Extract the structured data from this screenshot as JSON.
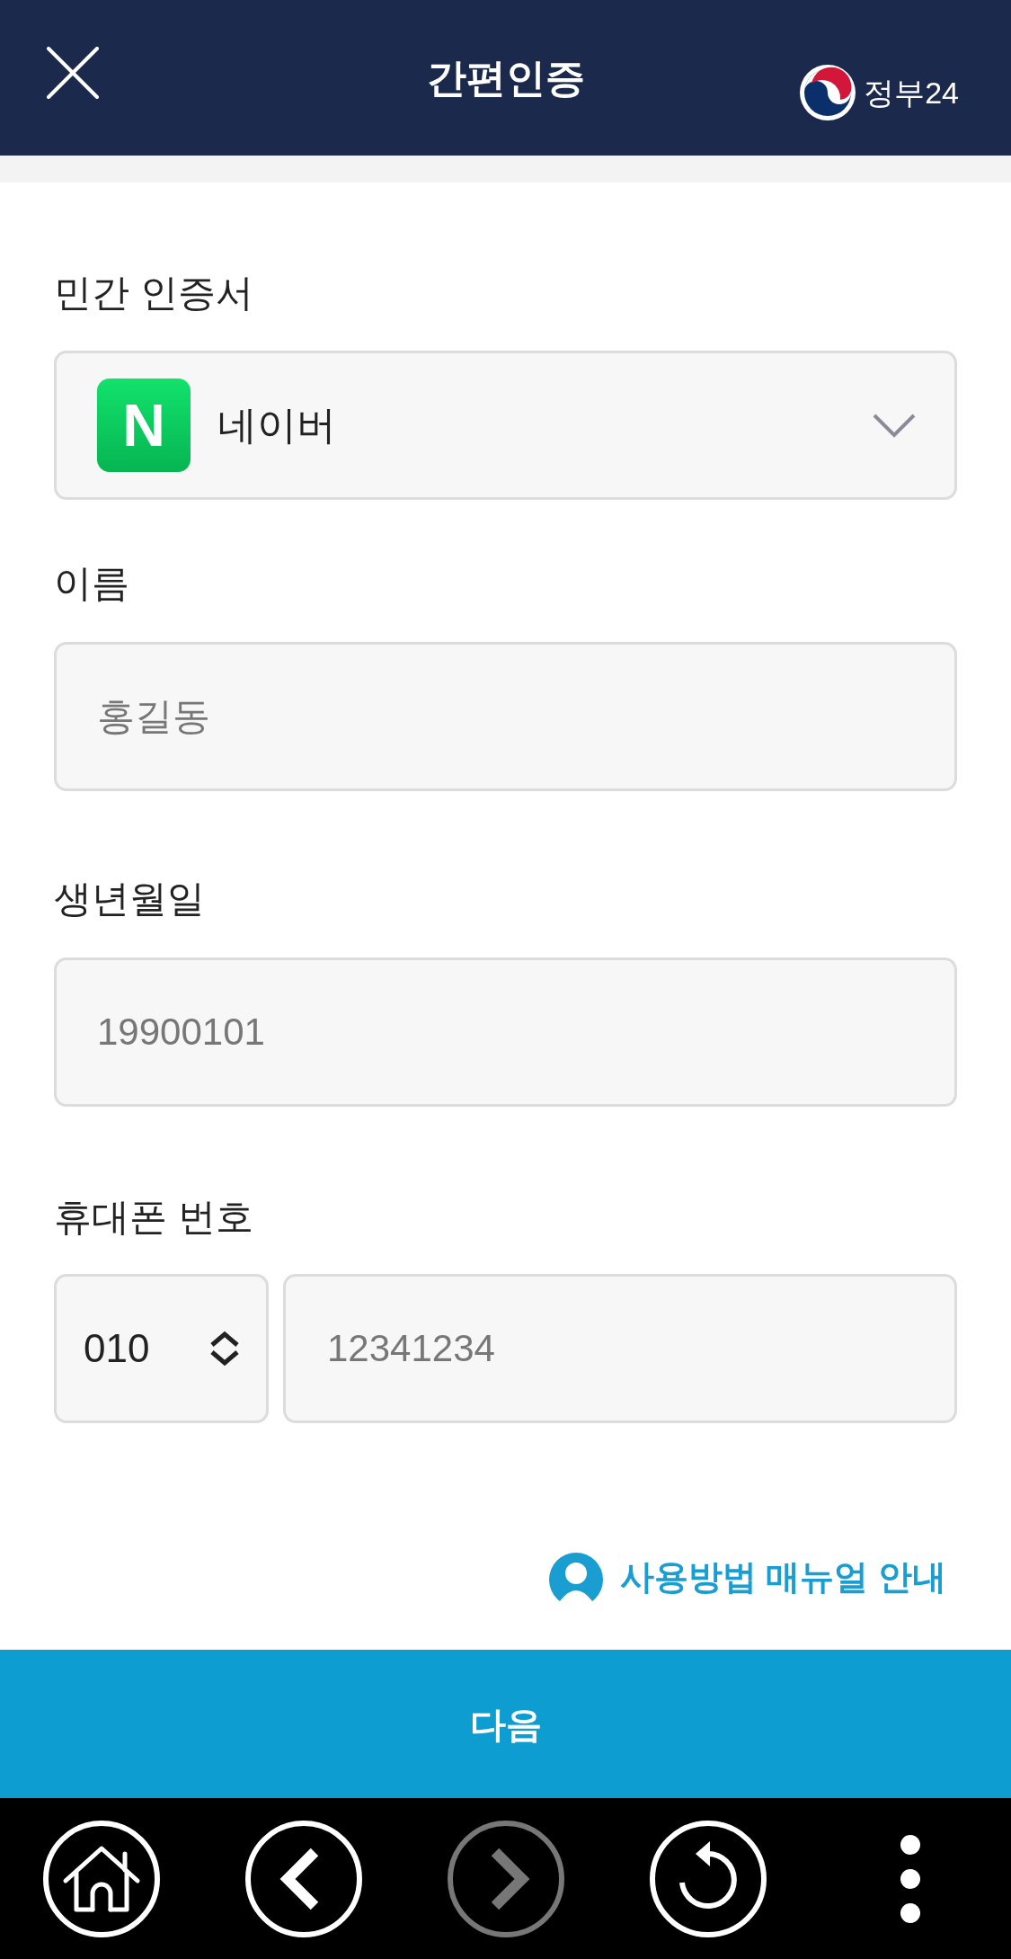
{
  "header": {
    "title": "간편인증",
    "logo_text": "정부24"
  },
  "form": {
    "certificate": {
      "label": "민간 인증서",
      "logo_letter": "N",
      "value": "네이버"
    },
    "fields": [
      {
        "label": "이름",
        "placeholder": "홍길동"
      },
      {
        "label": "생년월일",
        "placeholder": "19900101"
      }
    ],
    "phone": {
      "label": "휴대폰 번호",
      "prefix": "010",
      "placeholder": "12341234"
    }
  },
  "manual_link": "사용방법 매뉴얼 안내",
  "next_button": "다음",
  "nav_bar": {
    "buttons": [
      {
        "kind": "home",
        "disabled": false
      },
      {
        "kind": "back",
        "disabled": false
      },
      {
        "kind": "forward",
        "disabled": true
      },
      {
        "kind": "reload",
        "disabled": false
      },
      {
        "kind": "more",
        "disabled": false
      }
    ]
  }
}
